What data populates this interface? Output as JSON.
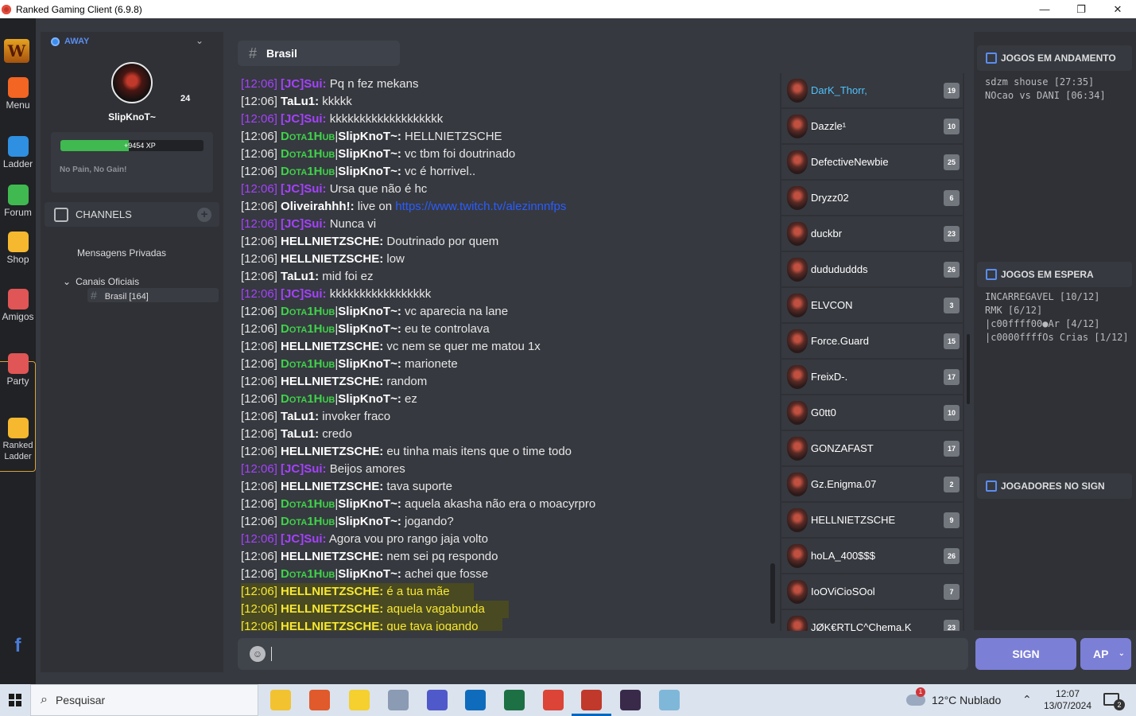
{
  "window": {
    "title": "Ranked Gaming Client (6.9.8)",
    "minimize": "—",
    "maximize": "❐",
    "close": "✕"
  },
  "rail": {
    "logo": "W",
    "items": [
      {
        "label": "Menu",
        "icon": "gear-icon",
        "color": "#f26522"
      },
      {
        "label": "Ladder",
        "icon": "bar-chart-icon",
        "color": "#2f8fe0"
      },
      {
        "label": "Forum",
        "icon": "terminal-icon",
        "color": "#3fb950"
      },
      {
        "label": "Shop",
        "icon": "coins-icon",
        "color": "#f5b82e"
      },
      {
        "label": "Amigos",
        "icon": "friends-icon",
        "color": "#e05555"
      },
      {
        "label": "Party",
        "icon": "crossed-swords-icon",
        "color": "#e05555"
      },
      {
        "label": "Ranked Ladder",
        "icon": "ranked-bars-icon",
        "color": "#f5b82e"
      }
    ],
    "facebook": "f"
  },
  "profile": {
    "status": "AWAY",
    "level": "24",
    "username": "SlipKnoT~",
    "xp_text": "+9454 XP",
    "xp_progress": 0.48,
    "motto": "No Pain, No Gain!"
  },
  "channels": {
    "header": "CHANNELS",
    "add": "+",
    "private_messages": "Mensagens Privadas",
    "category": "Canais Oficiais",
    "category_chevron": "⌄",
    "channel": {
      "hash": "#",
      "name": "Brasil [164]"
    }
  },
  "chat": {
    "channel_hash": "#",
    "channel_name": "Brasil",
    "messages": [
      {
        "ts": "[12:06]",
        "nick": "[JC]Sui:",
        "text": " Pq n fez mekans",
        "style": "jc"
      },
      {
        "ts": "[12:06]",
        "nick": "TaLu1:",
        "text": " kkkkk",
        "style": ""
      },
      {
        "ts": "[12:06]",
        "nick": "[JC]Sui:",
        "text": " kkkkkkkkkkkkkkkkkkk",
        "style": "jc"
      },
      {
        "ts": "[12:06]",
        "tag": "Dota1Hub",
        "nick": "SlipKnoT~:",
        "text": " HELLNIETZSCHE",
        "style": ""
      },
      {
        "ts": "[12:06]",
        "tag": "Dota1Hub",
        "nick": "SlipKnoT~:",
        "text": " vc tbm foi doutrinado",
        "style": ""
      },
      {
        "ts": "[12:06]",
        "tag": "Dota1Hub",
        "nick": "SlipKnoT~:",
        "text": " vc é horrivel..",
        "style": ""
      },
      {
        "ts": "[12:06]",
        "nick": "[JC]Sui:",
        "text": " Ursa que não é hc",
        "style": "jc"
      },
      {
        "ts": "[12:06]",
        "nick": "Oliveirahhh!:",
        "text": " live on ",
        "link": "https://www.twitch.tv/alezinnnfps",
        "style": ""
      },
      {
        "ts": "[12:06]",
        "nick": "[JC]Sui:",
        "text": " Nunca vi",
        "style": "jc"
      },
      {
        "ts": "[12:06]",
        "nick": "HELLNIETZSCHE:",
        "text": " Doutrinado por quem",
        "style": ""
      },
      {
        "ts": "[12:06]",
        "nick": "HELLNIETZSCHE:",
        "text": " low",
        "style": ""
      },
      {
        "ts": "[12:06]",
        "nick": "TaLu1:",
        "text": " mid foi ez",
        "style": ""
      },
      {
        "ts": "[12:06]",
        "nick": "[JC]Sui:",
        "text": " kkkkkkkkkkkkkkkkk",
        "style": "jc"
      },
      {
        "ts": "[12:06]",
        "tag": "Dota1Hub",
        "nick": "SlipKnoT~:",
        "text": " vc aparecia na lane",
        "style": ""
      },
      {
        "ts": "[12:06]",
        "tag": "Dota1Hub",
        "nick": "SlipKnoT~:",
        "text": " eu te controlava",
        "style": ""
      },
      {
        "ts": "[12:06]",
        "nick": "HELLNIETZSCHE:",
        "text": " vc nem se quer me matou 1x",
        "style": ""
      },
      {
        "ts": "[12:06]",
        "tag": "Dota1Hub",
        "nick": "SlipKnoT~:",
        "text": " marionete",
        "style": ""
      },
      {
        "ts": "[12:06]",
        "nick": "HELLNIETZSCHE:",
        "text": " random",
        "style": ""
      },
      {
        "ts": "[12:06]",
        "tag": "Dota1Hub",
        "nick": "SlipKnoT~:",
        "text": " ez",
        "style": ""
      },
      {
        "ts": "[12:06]",
        "nick": "TaLu1:",
        "text": " invoker fraco",
        "style": ""
      },
      {
        "ts": "[12:06]",
        "nick": "TaLu1:",
        "text": " credo",
        "style": ""
      },
      {
        "ts": "[12:06]",
        "nick": "HELLNIETZSCHE:",
        "text": " eu tinha mais itens que o time todo",
        "style": ""
      },
      {
        "ts": "[12:06]",
        "nick": "[JC]Sui:",
        "text": " Beijos amores",
        "style": "jc"
      },
      {
        "ts": "[12:06]",
        "nick": "HELLNIETZSCHE:",
        "text": " tava suporte",
        "style": ""
      },
      {
        "ts": "[12:06]",
        "tag": "Dota1Hub",
        "nick": "SlipKnoT~:",
        "text": " aquela akasha não era o moacyrpro",
        "style": ""
      },
      {
        "ts": "[12:06]",
        "tag": "Dota1Hub",
        "nick": "SlipKnoT~:",
        "text": " jogando?",
        "style": ""
      },
      {
        "ts": "[12:06]",
        "nick": "[JC]Sui:",
        "text": " Agora vou pro rango jaja volto",
        "style": "jc"
      },
      {
        "ts": "[12:06]",
        "nick": "HELLNIETZSCHE:",
        "text": " nem sei pq respondo",
        "style": ""
      },
      {
        "ts": "[12:06]",
        "tag": "Dota1Hub",
        "nick": "SlipKnoT~:",
        "text": " achei que fosse",
        "style": ""
      },
      {
        "ts": "[12:06]",
        "nick": "HELLNIETZSCHE:",
        "text": " é a tua mãe",
        "style": "hl"
      },
      {
        "ts": "[12:06]",
        "nick": "HELLNIETZSCHE:",
        "text": " aquela vagabunda",
        "style": "hl"
      },
      {
        "ts": "[12:06]",
        "nick": "HELLNIETZSCHE:",
        "text": " que tava jogando",
        "style": "hl"
      }
    ]
  },
  "players": [
    {
      "name": "DarK_Thorr,",
      "level": "19",
      "cyan": true
    },
    {
      "name": "Dazzle¹",
      "level": "10",
      "cyan": false
    },
    {
      "name": "DefectiveNewbie",
      "level": "25",
      "cyan": false
    },
    {
      "name": "Dryzz02",
      "level": "6",
      "cyan": false
    },
    {
      "name": "duckbr",
      "level": "23",
      "cyan": false
    },
    {
      "name": "dudududdds",
      "level": "26",
      "cyan": false
    },
    {
      "name": "ELVCON",
      "level": "3",
      "cyan": false
    },
    {
      "name": "Force.Guard",
      "level": "15",
      "cyan": false
    },
    {
      "name": "FreixD-.",
      "level": "17",
      "cyan": false
    },
    {
      "name": "G0tt0",
      "level": "10",
      "cyan": false
    },
    {
      "name": "GONZAFAST",
      "level": "17",
      "cyan": false
    },
    {
      "name": "Gz.Enigma.07",
      "level": "2",
      "cyan": false
    },
    {
      "name": "HELLNIETZSCHE",
      "level": "9",
      "cyan": false
    },
    {
      "name": "hoLA_400$$$",
      "level": "26",
      "cyan": false
    },
    {
      "name": "IoOViCioSOol",
      "level": "7",
      "cyan": false
    },
    {
      "name": "JØK€RTLC^Chema.K",
      "level": "23",
      "cyan": false
    }
  ],
  "right_panel": {
    "in_progress": {
      "title": "JOGOS EM ANDAMENTO",
      "games": [
        "sdzm shouse [27:35]",
        "NOcao vs DANI [06:34]"
      ]
    },
    "waiting": {
      "title": "JOGOS EM ESPERA",
      "games": [
        "INCARREGAVEL [10/12]",
        "RMK [6/12]",
        "|c00ffff00●Ar [4/12]",
        "|c0000ffffOs Crias [1/12]"
      ]
    },
    "sign": {
      "title": "JOGADORES NO SIGN"
    }
  },
  "input": {
    "emoji": "☺",
    "sign_label": "SIGN",
    "ap_label": "AP",
    "ap_chevron": "⌄"
  },
  "taskbar": {
    "search_placeholder": "Pesquisar",
    "search_icon": "⌕",
    "weather": "12°C  Nublado",
    "up_arrow": "⌃",
    "time": "12:07",
    "date": "13/07/2024",
    "notifications": "2",
    "apps": [
      {
        "icon": "file-explorer-icon",
        "color": "#f2c230"
      },
      {
        "icon": "app-orange-icon",
        "color": "#e05a2b"
      },
      {
        "icon": "sticky-notes-icon",
        "color": "#f5d02e"
      },
      {
        "icon": "paint-icon",
        "color": "#8a9bb3"
      },
      {
        "icon": "teams-icon",
        "color": "#5059c9"
      },
      {
        "icon": "outlook-icon",
        "color": "#0f6cbd"
      },
      {
        "icon": "excel-icon",
        "color": "#1d7044"
      },
      {
        "icon": "chrome-icon",
        "color": "#db4437"
      },
      {
        "icon": "ranked-client-icon",
        "color": "#c0392b"
      },
      {
        "icon": "warcraft-icon",
        "color": "#3a2a4a"
      },
      {
        "icon": "notepad-icon",
        "color": "#7fb7d9"
      }
    ]
  }
}
